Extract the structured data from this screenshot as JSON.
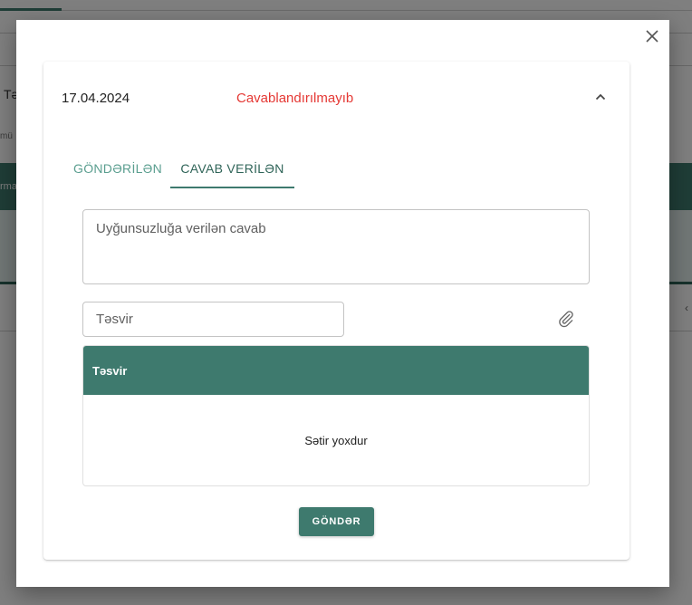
{
  "background": {
    "heading_fragment": "Tə",
    "small_fragment": "mü",
    "band_fragment": "rma"
  },
  "accordion": {
    "date": "17.04.2024",
    "status": "Cavablandırılmayıb",
    "expanded": true
  },
  "tabs": [
    {
      "label": "GÖNDƏRİLƏN",
      "active": false
    },
    {
      "label": "CAVAB VERİLƏN",
      "active": true
    }
  ],
  "reply": {
    "placeholder": "Uyğunsuzluğa verilən cavab",
    "value": ""
  },
  "description": {
    "placeholder": "Təsvir",
    "value": ""
  },
  "table": {
    "columns": [
      "Təsvir"
    ],
    "rows": [],
    "empty_text": "Sətir yoxdur"
  },
  "actions": {
    "send_label": "GÖNDƏR"
  },
  "colors": {
    "primary": "#3e7a6e",
    "status_red": "#e53935",
    "tab_inactive": "#5a9e8f"
  },
  "icons": {
    "close": "close-icon",
    "collapse": "chevron-up-icon",
    "attach": "paperclip-icon"
  }
}
